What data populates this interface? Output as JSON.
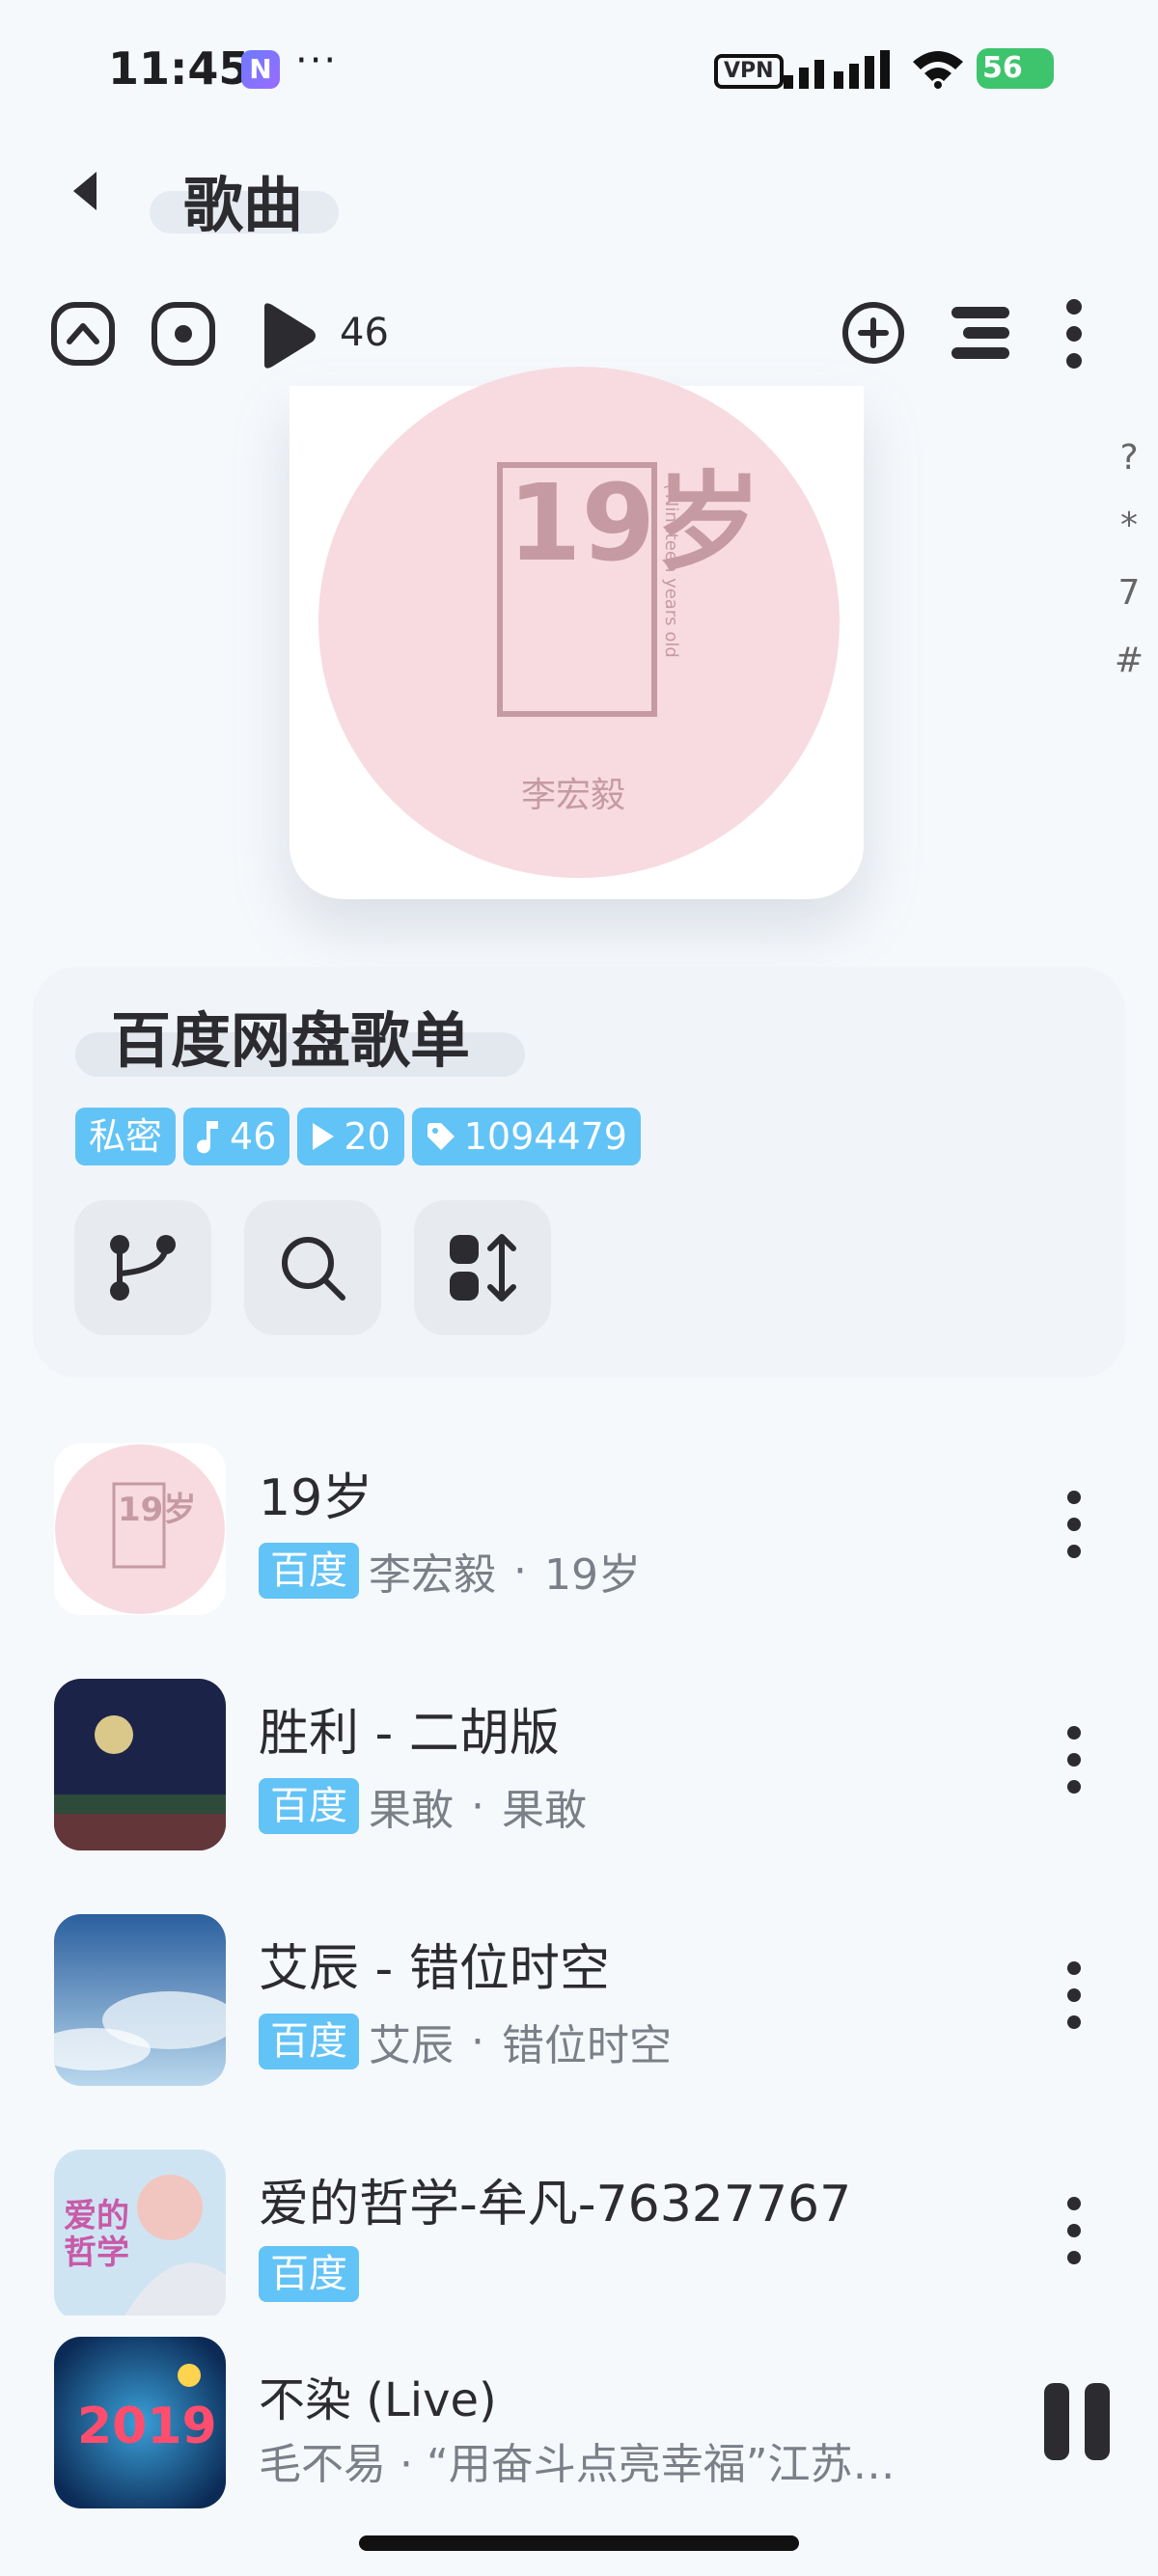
{
  "status_bar": {
    "time": "11:45",
    "n_badge": "N",
    "dots": "···",
    "vpn": "VPN",
    "battery": "56"
  },
  "header": {
    "title": "歌曲"
  },
  "toolbar": {
    "play_count": "46"
  },
  "az_index": [
    "?",
    "*",
    "7",
    "#"
  ],
  "playlist": {
    "title": "百度网盘歌单",
    "tag_private": "私密",
    "tag_songs": "46",
    "tag_plays": "20",
    "tag_id": "1094479"
  },
  "songs": [
    {
      "name": "19岁",
      "source": "百度",
      "artist": "李宏毅",
      "sep": "·",
      "album": "19岁"
    },
    {
      "name": "胜利 - 二胡版",
      "source": "百度",
      "artist": "果敢",
      "sep": "·",
      "album": "果敢"
    },
    {
      "name": "艾辰 - 错位时空",
      "source": "百度",
      "artist": "艾辰",
      "sep": "·",
      "album": "错位时空"
    },
    {
      "name": "爱的哲学-牟凡-76327767",
      "source": "百度",
      "artist": "",
      "sep": "",
      "album": ""
    }
  ],
  "player": {
    "title": "不染 (Live)",
    "subtitle": "毛不易 · “用奋斗点亮幸福”江苏…"
  },
  "cover_text": {
    "number": "19岁",
    "signature": "李宏毅",
    "side": "\\ Nineteen years old"
  },
  "colors": {
    "tag": "#62c3f6",
    "cover_pink": "#f7dbe0",
    "cover_text": "#c69aa3"
  }
}
